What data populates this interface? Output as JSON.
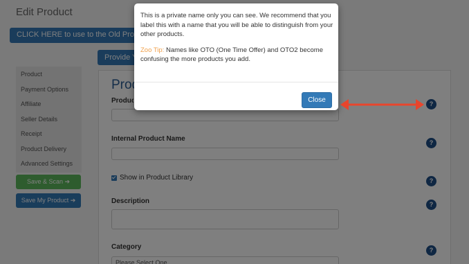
{
  "page": {
    "title": "Edit Product",
    "old_builder_button": "CLICK HERE to use to the Old Product B",
    "provide_button": "Provide Yo"
  },
  "sidebar": {
    "items": [
      {
        "label": "Product"
      },
      {
        "label": "Payment Options"
      },
      {
        "label": "Affiliate"
      },
      {
        "label": "Seller Details"
      },
      {
        "label": "Receipt"
      },
      {
        "label": "Product Delivery"
      },
      {
        "label": "Advanced Settings"
      }
    ],
    "save_scan_label": "Save & Scan ➔",
    "save_product_label": "Save My Product ➔"
  },
  "form": {
    "section_heading": "Prod",
    "product_name_label": "Produc",
    "internal_name_label": "Internal Product Name",
    "show_library_label": "Show in Product Library",
    "description_label": "Description",
    "category_label": "Category",
    "category_value": "Please Select One",
    "help_glyph": "?"
  },
  "modal": {
    "paragraph": "This is a private name only you can see. We recommend that you label this with a name that you will be able to distinguish from your other products.",
    "tip_label": "Zoo Tip:",
    "tip_text": " Names like OTO (One Time Offer) and OTO2 become confusing the more products you add.",
    "close_label": "Close"
  },
  "colors": {
    "primary_button": "#337ab7",
    "success_button": "#5cb85c",
    "tip_accent": "#f0a04b",
    "annotation_arrow": "#e8452c"
  },
  "icons": {
    "help": "question-circle-icon",
    "arrow": "arrow-right-icon",
    "annotation": "double-headed-arrow-icon"
  }
}
